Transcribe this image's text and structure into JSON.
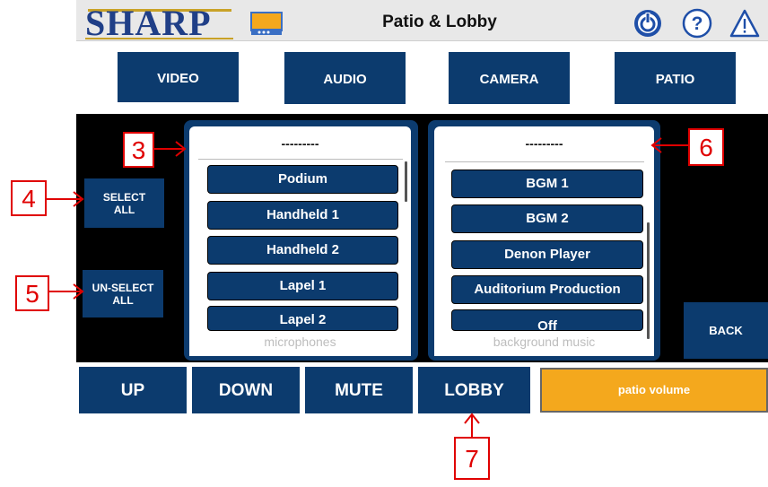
{
  "header": {
    "logo": "SHARP",
    "title": "Patio & Lobby"
  },
  "nav": {
    "video": "VIDEO",
    "audio": "AUDIO",
    "camera": "CAMERA",
    "patio": "PATIO"
  },
  "side": {
    "select_all": "SELECT\nALL",
    "unselect_all": "UN-SELECT\nALL",
    "back": "BACK"
  },
  "microphones": {
    "header": "---------",
    "items": [
      "Podium",
      "Handheld 1",
      "Handheld 2",
      "Lapel 1",
      "Lapel 2"
    ],
    "caption": "microphones"
  },
  "background_music": {
    "header": "---------",
    "items": [
      "BGM 1",
      "BGM 2",
      "Denon Player",
      "Auditorium Production",
      "Off"
    ],
    "caption": "background music"
  },
  "bottom": {
    "up": "UP",
    "down": "DOWN",
    "mute": "MUTE",
    "lobby": "LOBBY",
    "volume": "patio volume"
  },
  "annotations": [
    "3",
    "4",
    "5",
    "6",
    "7"
  ],
  "colors": {
    "button": "#0c3b6e",
    "accent": "#f4a81d",
    "callout": "#e00000"
  },
  "icons": [
    "projector-icon",
    "power-icon",
    "help-icon",
    "warning-icon"
  ]
}
